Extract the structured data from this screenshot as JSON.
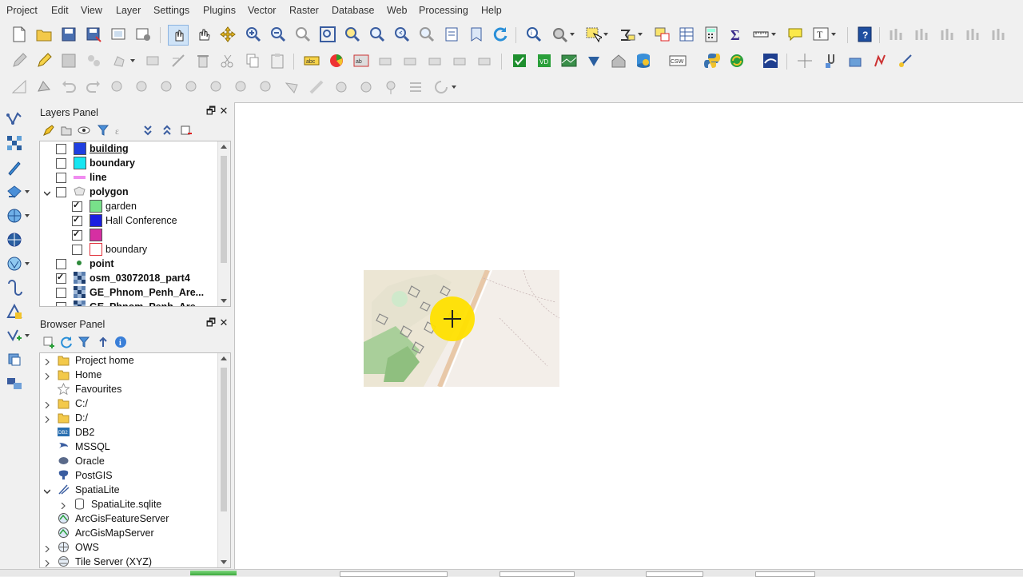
{
  "menubar": [
    "Project",
    "Edit",
    "View",
    "Layer",
    "Settings",
    "Plugins",
    "Vector",
    "Raster",
    "Database",
    "Web",
    "Processing",
    "Help"
  ],
  "layers_panel": {
    "title": "Layers Panel",
    "restore_glyph": "🗗",
    "close_glyph": "✕",
    "items": [
      {
        "label": "building",
        "bold": true,
        "underline": true,
        "checked": false,
        "swatch": "#1f3fe0",
        "indent": 0
      },
      {
        "label": "boundary",
        "bold": true,
        "checked": false,
        "swatch": "#17e6f2",
        "indent": 0
      },
      {
        "label": "line",
        "bold": true,
        "checked": false,
        "swatch": "#f08cf0",
        "swatch_type": "line",
        "indent": 0
      },
      {
        "label": "polygon",
        "bold": true,
        "checked": false,
        "swatch": "#d8d8d8",
        "swatch_type": "group",
        "expanded": true,
        "indent": 0
      },
      {
        "label": "garden",
        "bold": false,
        "checked": true,
        "swatch": "#78e08a",
        "indent": 1
      },
      {
        "label": "Hall Conference",
        "bold": false,
        "checked": true,
        "swatch": "#1a1ee0",
        "indent": 1
      },
      {
        "label": "",
        "bold": false,
        "checked": true,
        "swatch": "#d62fa2",
        "indent": 1
      },
      {
        "label": "boundary",
        "bold": false,
        "checked": false,
        "swatch": "#ffffff",
        "swatch_border": "#e0303a",
        "indent": 1
      },
      {
        "label": "point",
        "bold": true,
        "checked": false,
        "swatch": "#2d8a3a",
        "swatch_type": "point",
        "indent": 0
      },
      {
        "label": "osm_03072018_part4",
        "bold": true,
        "checked": true,
        "swatch_type": "raster",
        "indent": 0
      },
      {
        "label": "GE_Phnom_Penh_Are...",
        "bold": true,
        "checked": false,
        "swatch_type": "raster",
        "indent": 0
      },
      {
        "label": "GE_Phnom_Penh_Are...",
        "bold": true,
        "checked": false,
        "swatch_type": "raster",
        "indent": 0
      }
    ]
  },
  "browser_panel": {
    "title": "Browser Panel",
    "restore_glyph": "🗗",
    "close_glyph": "✕",
    "items": [
      {
        "label": "Project home",
        "icon": "folder-icon",
        "expandable": true,
        "indent": 0
      },
      {
        "label": "Home",
        "icon": "folder-icon",
        "expandable": true,
        "indent": 0
      },
      {
        "label": "Favourites",
        "icon": "star-icon",
        "expandable": false,
        "indent": 0
      },
      {
        "label": "C:/",
        "icon": "folder-icon",
        "expandable": true,
        "indent": 0
      },
      {
        "label": "D:/",
        "icon": "folder-icon",
        "expandable": true,
        "indent": 0
      },
      {
        "label": "DB2",
        "icon": "db2-icon",
        "expandable": false,
        "indent": 0
      },
      {
        "label": "MSSQL",
        "icon": "mssql-icon",
        "expandable": false,
        "indent": 0
      },
      {
        "label": "Oracle",
        "icon": "oracle-icon",
        "expandable": false,
        "indent": 0
      },
      {
        "label": "PostGIS",
        "icon": "postgis-icon",
        "expandable": false,
        "indent": 0
      },
      {
        "label": "SpatiaLite",
        "icon": "spatialite-icon",
        "expandable": true,
        "expanded": true,
        "indent": 0
      },
      {
        "label": "SpatiaLite.sqlite",
        "icon": "database-icon",
        "expandable": true,
        "indent": 1
      },
      {
        "label": "ArcGisFeatureServer",
        "icon": "arcgis-icon",
        "expandable": false,
        "indent": 0
      },
      {
        "label": "ArcGisMapServer",
        "icon": "arcgis-icon",
        "expandable": false,
        "indent": 0
      },
      {
        "label": "OWS",
        "icon": "globe-icon",
        "expandable": true,
        "indent": 0
      },
      {
        "label": "Tile Server (XYZ)",
        "icon": "xyz-icon",
        "expandable": true,
        "indent": 0
      }
    ],
    "db2_badge": "DB2"
  },
  "colors": {
    "cursor_highlight": "#ffe000",
    "map_bg": "#ffffff"
  }
}
